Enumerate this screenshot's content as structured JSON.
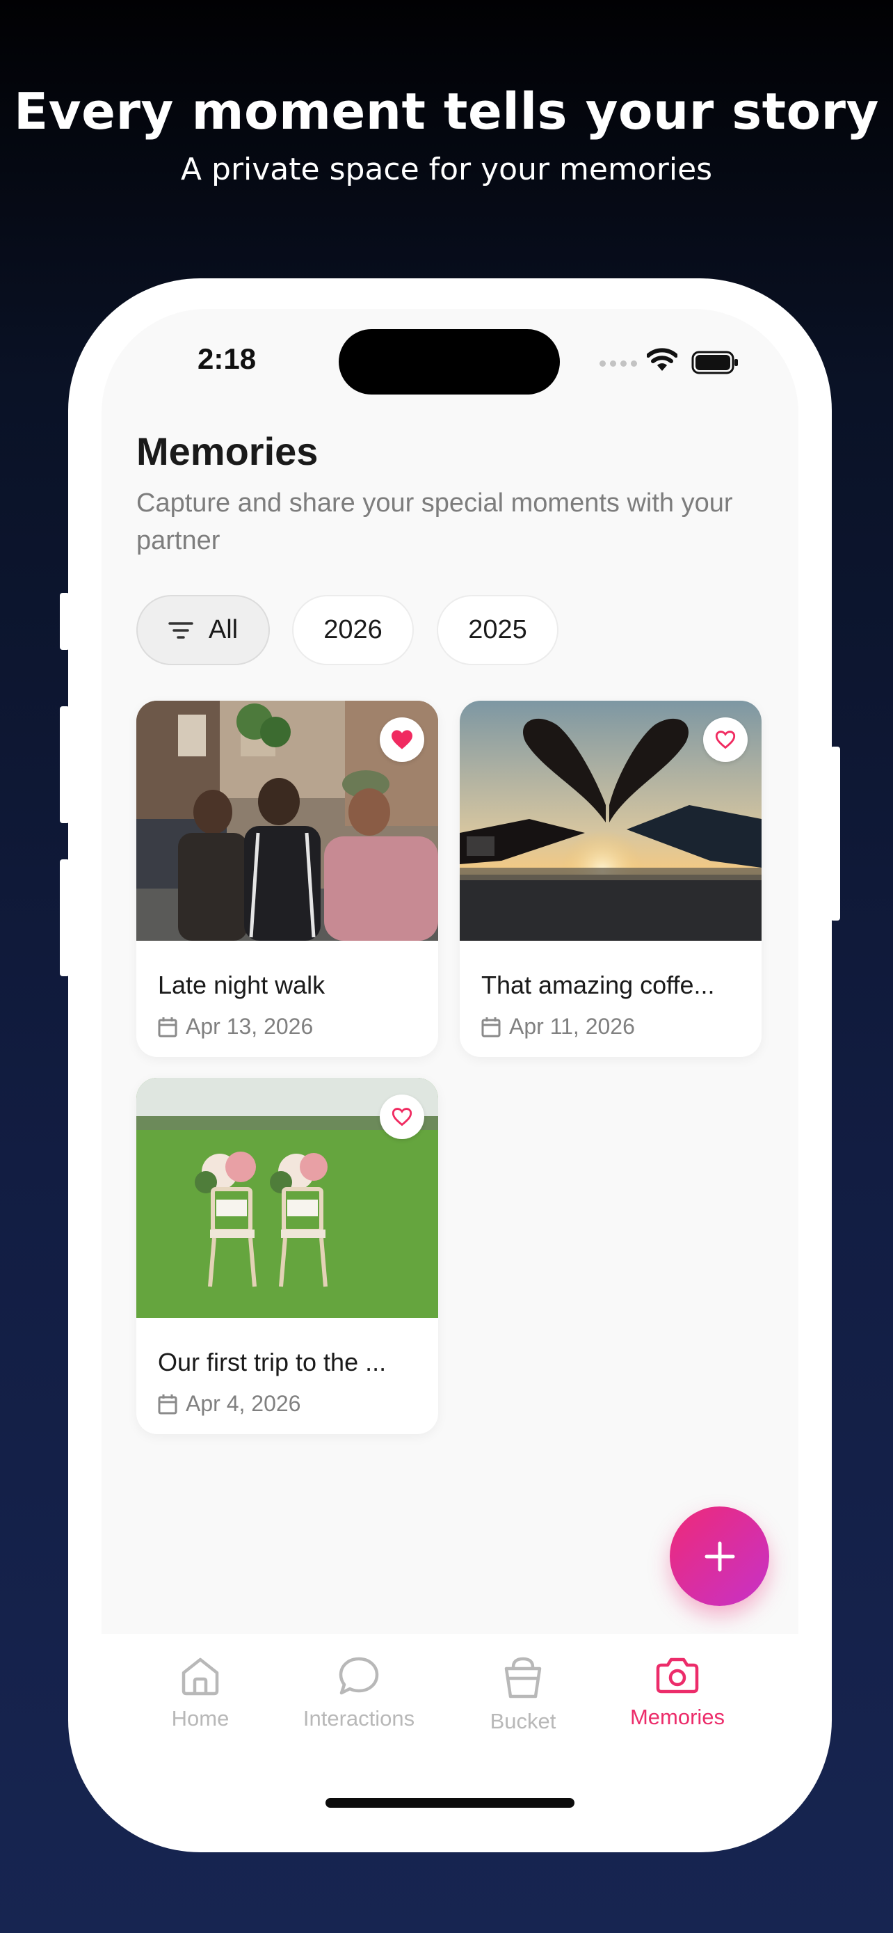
{
  "hero": {
    "title": "Every moment tells your story",
    "subtitle": "A private space for your memories"
  },
  "status_bar": {
    "time": "2:18"
  },
  "page": {
    "title": "Memories",
    "description": "Capture and share your special moments with your partner"
  },
  "filters": [
    {
      "label": "All",
      "icon": "filter-icon",
      "active": true
    },
    {
      "label": "2026",
      "active": false
    },
    {
      "label": "2025",
      "active": false
    }
  ],
  "memories": [
    {
      "title": "Late night walk",
      "date": "Apr 13, 2026",
      "favorite": true,
      "image": "friends-laughing-photo"
    },
    {
      "title": "That amazing coffe...",
      "date": "Apr 11, 2026",
      "favorite": false,
      "image": "heart-hands-sunset-photo"
    },
    {
      "title": "Our first trip to the ...",
      "date": "Apr 4, 2026",
      "favorite": false,
      "image": "wedding-chairs-lawn-photo"
    }
  ],
  "fab": {
    "icon": "plus-icon"
  },
  "tabs": [
    {
      "label": "Home",
      "icon": "home-icon",
      "active": false
    },
    {
      "label": "Interactions",
      "icon": "chat-bubble-icon",
      "active": false
    },
    {
      "label": "Bucket",
      "icon": "bucket-icon",
      "active": false
    },
    {
      "label": "Memories",
      "icon": "camera-icon",
      "active": true
    }
  ],
  "colors": {
    "accent": "#ec2c6a",
    "fab_gradient_start": "#ee2a78",
    "fab_gradient_end": "#c632c8",
    "background_top": "#010103",
    "background_bottom": "#172551"
  }
}
